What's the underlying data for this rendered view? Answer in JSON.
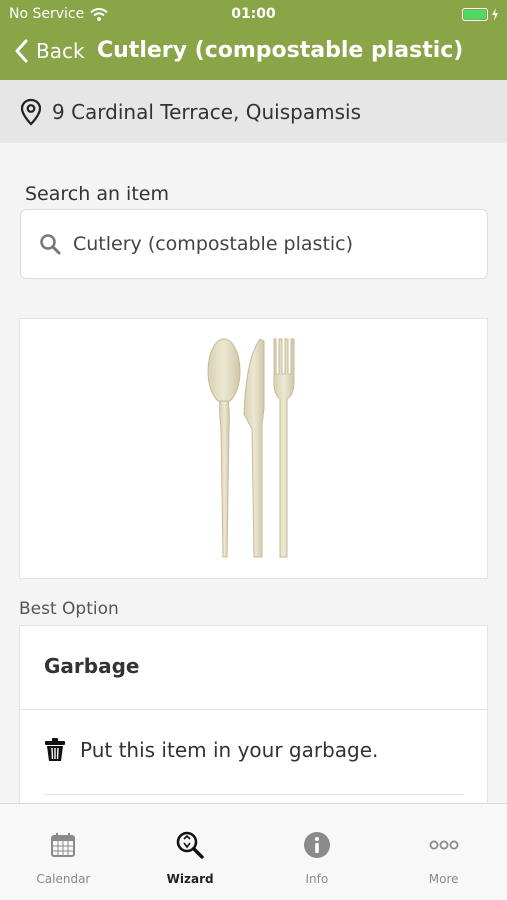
{
  "status_bar": {
    "carrier": "No Service",
    "time": "01:00"
  },
  "nav": {
    "back_label": "Back",
    "title": "Cutlery (compostable plastic)"
  },
  "address": {
    "text": "9 Cardinal Terrace, Quispamsis"
  },
  "search": {
    "label": "Search an item",
    "value": "Cutlery (compostable plastic)"
  },
  "best_option": {
    "section_label": "Best Option",
    "title": "Garbage",
    "instruction": "Put this item in your garbage."
  },
  "tabs": [
    {
      "label": "Calendar",
      "icon": "calendar-icon",
      "active": false
    },
    {
      "label": "Wizard",
      "icon": "wizard-search-icon",
      "active": true
    },
    {
      "label": "Info",
      "icon": "info-icon",
      "active": false
    },
    {
      "label": "More",
      "icon": "more-icon",
      "active": false
    }
  ],
  "colors": {
    "header": "#8aa448",
    "battery": "#4cd964"
  }
}
